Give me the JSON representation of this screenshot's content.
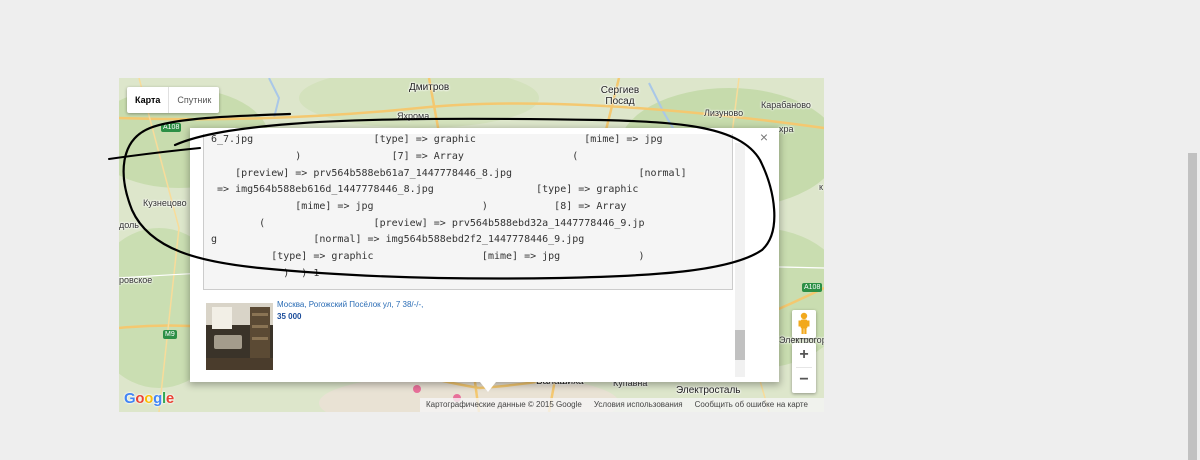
{
  "map_type": {
    "map_label": "Карта",
    "satellite_label": "Спутник"
  },
  "places": {
    "dmitrov": "Дмитров",
    "yakhroma": "Яхрома",
    "sergiev_posad": "Сергиев Посад",
    "lizunovo": "Лизуново",
    "karabanovo": "Карабаново",
    "kuznetsovo": "Кузнецово",
    "balashikha": "Балашиха",
    "kupavna": "Купавна",
    "elektrostal": "Электросталь",
    "elektrogorsk": "Электрогорс",
    "left_edge_1": "доль",
    "left_edge_2": "ровское",
    "right_edge_1": "хра",
    "right_edge_2": "к",
    "hwy_a108_top": "А108",
    "hwy_m9": "М9",
    "hwy_a108_right": "А108"
  },
  "debug_lines": [
    "6_7.jpg                    [type] => graphic                  [mime] => jpg",
    "              )               [7] => Array                  (",
    "    [preview] => prv564b588eb61a7_1447778446_8.jpg                     [normal]",
    " => img564b588eb616d_1447778446_8.jpg                 [type] => graphic",
    "              [mime] => jpg                  )           [8] => Array",
    "        (                  [preview] => prv564b588ebd32a_1447778446_9.jp",
    "g                [normal] => img564b588ebd2f2_1447778446_9.jpg",
    "          [type] => graphic                  [mime] => jpg             )",
    "            )  ) 1"
  ],
  "listing": {
    "address": "Москва, Рогожский Посёлок ул, 7 38/-/-,",
    "price": "35 000"
  },
  "google_logo": {
    "g1": "G",
    "o1": "o",
    "o2": "o",
    "g2": "g",
    "l": "l",
    "e": "e"
  },
  "attribution": {
    "map_data": "Картографические данные © 2015 Google",
    "terms": "Условия использования",
    "report": "Сообщить об ошибке на карте"
  },
  "zoom": {
    "in": "+",
    "out": "−"
  },
  "close_glyph": "×",
  "icons": {
    "pegman": "pegman-icon",
    "close": "close-icon"
  },
  "colors": {
    "map_bg": "#dfe8cf",
    "link_blue": "#2a6cb5",
    "price_blue": "#1a4c9a",
    "annotation": "#000000"
  }
}
